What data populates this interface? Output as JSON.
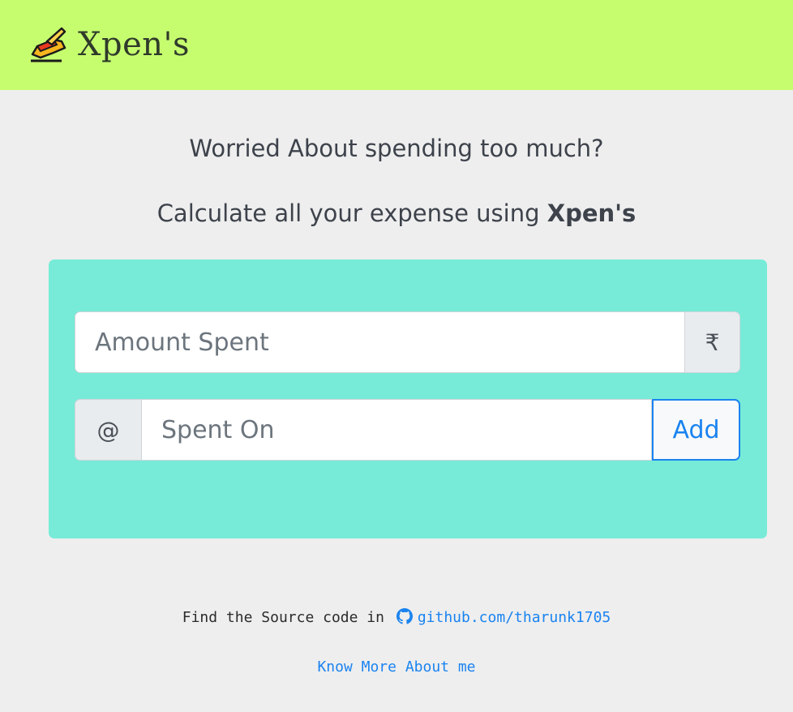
{
  "header": {
    "brand_name": "Xpen's",
    "brand_icon": "writing-hand-icon",
    "background": "#c6fd6f"
  },
  "hero": {
    "line1": "Worried About spending too much?",
    "line2_prefix": "Calculate all your expense using ",
    "line2_brand": "Xpen's"
  },
  "form": {
    "amount_placeholder": "Amount Spent",
    "currency_symbol": "₹",
    "at_symbol": "@",
    "spent_on_placeholder": "Spent On",
    "add_label": "Add",
    "card_color": "#77ebd7",
    "accent": "#1a83f0"
  },
  "footer": {
    "source_prefix": "Find the Source code in",
    "github_icon": "github-icon",
    "github_link": "github.com/tharunk1705",
    "about_link": "Know More About me"
  }
}
